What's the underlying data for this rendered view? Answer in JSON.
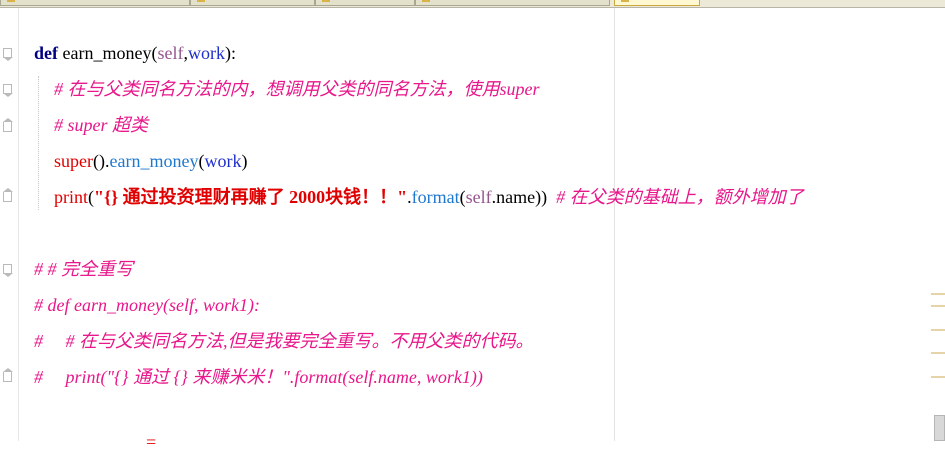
{
  "editor": {
    "lines": [
      {
        "id": "def",
        "tokens": [
          {
            "t": "def",
            "c": "kw"
          },
          {
            "t": " earn_money(",
            "c": "fn"
          },
          {
            "t": "self",
            "c": "self"
          },
          {
            "t": ",",
            "c": "plain"
          },
          {
            "t": "work",
            "c": "param"
          },
          {
            "t": "):",
            "c": "plain"
          }
        ]
      },
      {
        "id": "comment-1",
        "tokens": [
          {
            "t": "# 在与父类同名方法的内，想调用父类的同名方法，使用super",
            "c": "cmt"
          }
        ]
      },
      {
        "id": "comment-2",
        "tokens": [
          {
            "t": "# super 超类",
            "c": "cmt"
          }
        ]
      },
      {
        "id": "super-call",
        "tokens": [
          {
            "t": "super",
            "c": "builtin"
          },
          {
            "t": "().",
            "c": "plain"
          },
          {
            "t": "earn_money",
            "c": "method"
          },
          {
            "t": "(",
            "c": "plain"
          },
          {
            "t": "work",
            "c": "param"
          },
          {
            "t": ")",
            "c": "plain"
          }
        ]
      },
      {
        "id": "print-call",
        "tokens": [
          {
            "t": "print",
            "c": "builtin"
          },
          {
            "t": "(",
            "c": "plain"
          },
          {
            "t": "\"{} 通过投资理财再赚了 2000块钱！！\"",
            "c": "str"
          },
          {
            "t": ".",
            "c": "plain"
          },
          {
            "t": "format",
            "c": "method"
          },
          {
            "t": "(",
            "c": "plain"
          },
          {
            "t": "self",
            "c": "self"
          },
          {
            "t": ".name))",
            "c": "plain"
          },
          {
            "t": "  # 在父类的基础上，额外增加了",
            "c": "cmt"
          }
        ]
      },
      {
        "id": "comment-3",
        "tokens": [
          {
            "t": "# # 完全重写",
            "c": "cmt"
          }
        ]
      },
      {
        "id": "comment-4",
        "tokens": [
          {
            "t": "# def earn_money(self, work1):",
            "c": "cmt"
          }
        ]
      },
      {
        "id": "comment-5",
        "tokens": [
          {
            "t": "#     # 在与父类同名方法,但是我要完全重写。不用父类的代码。",
            "c": "cmt"
          }
        ]
      },
      {
        "id": "comment-6",
        "tokens": [
          {
            "t": "#     print(\"{} 通过 {} 来赚米米！\".format(self.name, work1))",
            "c": "cmt"
          }
        ]
      }
    ],
    "bottom_partial_glyph": "="
  },
  "colors": {
    "keyword": "#000080",
    "builtin": "#e00000",
    "method": "#1f78d0",
    "comment": "#e8178a",
    "self": "#94558d"
  }
}
